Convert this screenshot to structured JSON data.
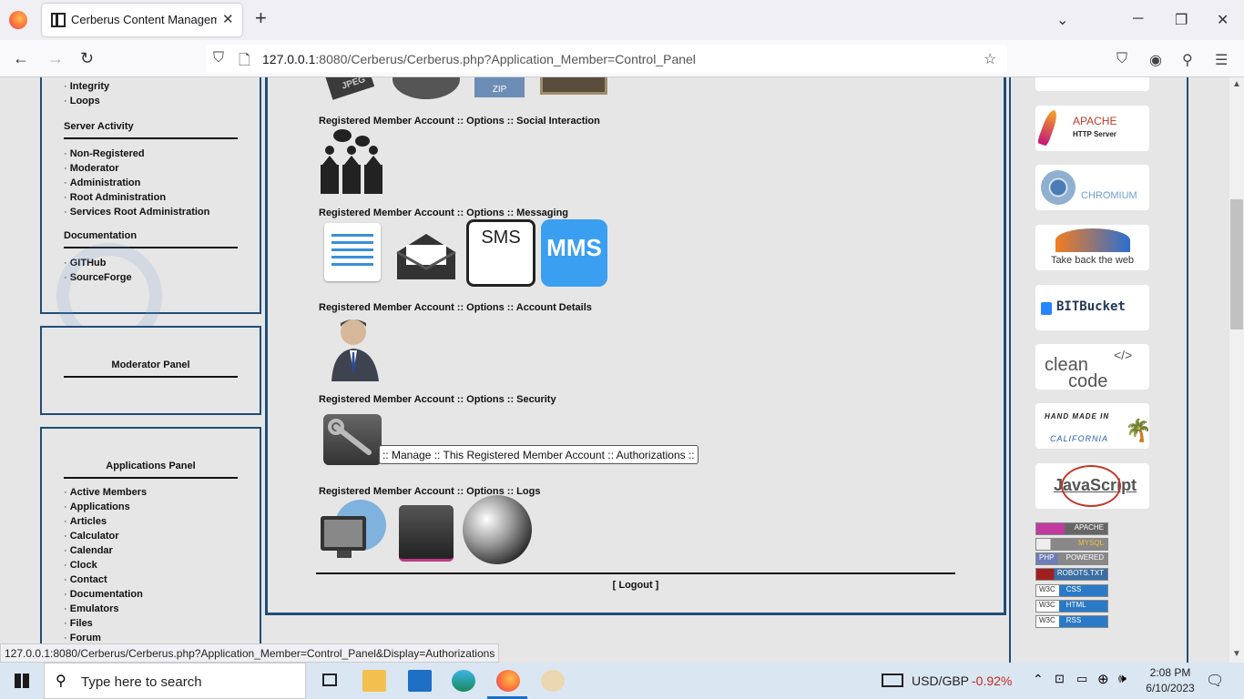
{
  "browser": {
    "tab_title": "Cerberus Content Management",
    "url_host": "127.0.0.1",
    "url_rest": ":8080/Cerberus/Cerberus.php?Application_Member=Control_Panel"
  },
  "left": {
    "top_items": [
      "Integrity",
      "Loops"
    ],
    "server_activity": {
      "title": "Server Activity",
      "items": [
        "Non-Registered",
        "Moderator",
        "Administration",
        "Root Administration",
        "Services Root Administration"
      ]
    },
    "documentation": {
      "title": "Documentation",
      "items": [
        "GITHub",
        "SourceForge"
      ]
    },
    "moderator": {
      "title": "Moderator Panel"
    },
    "applications": {
      "title": "Applications Panel",
      "items": [
        "Active Members",
        "Applications",
        "Articles",
        "Calculator",
        "Calendar",
        "Clock",
        "Contact",
        "Documentation",
        "Emulators",
        "Files",
        "Forum"
      ]
    }
  },
  "center": {
    "sections": [
      "Registered Member Account :: Options :: Social Interaction",
      "Registered Member Account :: Options :: Messaging",
      "Registered Member Account :: Options :: Account Details",
      "Registered Member Account :: Options :: Security",
      "Registered Member Account :: Options :: Logs"
    ],
    "top_icon_labels": {
      "zip": "ZIP",
      "jpeg": "JPEG"
    },
    "messaging_labels": {
      "sms": "SMS",
      "mms": "MMS"
    },
    "tooltip": ":: Manage :: This Registered Member Account :: Authorizations ::",
    "logout": "[ Logout ]"
  },
  "right": {
    "badges": {
      "apache_line1": "APACHE",
      "apache_line2": "HTTP Server",
      "chromium": "CHROMIUM",
      "firefox": "Take back the web",
      "bitbucket": "BITBucket",
      "clean1": "clean",
      "clean2": "code",
      "hand1": "HAND MADE IN",
      "hand2": "CALIFORNIA",
      "js": "JavaScript"
    },
    "small_badges": [
      {
        "left": "",
        "right": "APACHE"
      },
      {
        "left": "",
        "right": "MYSQL"
      },
      {
        "left": "PHP",
        "right": "POWERED"
      },
      {
        "left": "",
        "right": "ROBOTS.TXT"
      },
      {
        "left": "W3C",
        "right": "CSS"
      },
      {
        "left": "W3C",
        "right": "HTML"
      },
      {
        "left": "W3C",
        "right": "RSS"
      }
    ]
  },
  "status_url": "127.0.0.1:8080/Cerberus/Cerberus.php?Application_Member=Control_Panel&Display=Authorizations",
  "taskbar": {
    "search_placeholder": "Type here to search",
    "ticker_label": "USD/GBP",
    "ticker_value": "-0.92%",
    "time": "2:08 PM",
    "date": "6/10/2023"
  }
}
